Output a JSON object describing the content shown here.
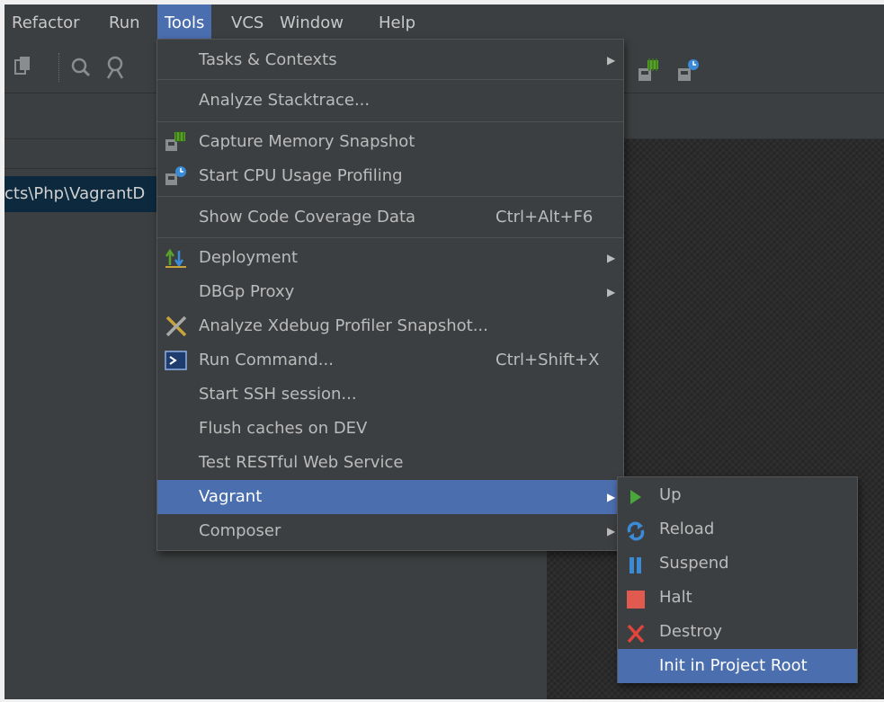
{
  "menubar": {
    "items": [
      "Refactor",
      "Run",
      "Tools",
      "VCS",
      "Window",
      "Help"
    ]
  },
  "left_panel": {
    "path_text": "cts\\Php\\VagrantD"
  },
  "tools_menu": {
    "items": [
      {
        "label": "Tasks & Contexts"
      },
      {
        "label": "Analyze Stacktrace..."
      },
      {
        "label": "Capture Memory Snapshot"
      },
      {
        "label": "Start CPU Usage Profiling"
      },
      {
        "label": "Show Code Coverage Data",
        "shortcut": "Ctrl+Alt+F6"
      },
      {
        "label": "Deployment"
      },
      {
        "label": "DBGp Proxy"
      },
      {
        "label": "Analyze Xdebug Profiler Snapshot..."
      },
      {
        "label": "Run Command...",
        "shortcut": "Ctrl+Shift+X"
      },
      {
        "label": "Start SSH session..."
      },
      {
        "label": "Flush caches on DEV"
      },
      {
        "label": "Test RESTful Web Service"
      },
      {
        "label": "Vagrant"
      },
      {
        "label": "Composer"
      }
    ]
  },
  "vagrant_menu": {
    "items": [
      {
        "label": "Up"
      },
      {
        "label": "Reload"
      },
      {
        "label": "Suspend"
      },
      {
        "label": "Halt"
      },
      {
        "label": "Destroy"
      },
      {
        "label": "Init in Project Root"
      }
    ]
  },
  "colors": {
    "selection": "#4b6eaf",
    "menu_bg": "#3c3f41",
    "text": "#bbbbbb"
  }
}
